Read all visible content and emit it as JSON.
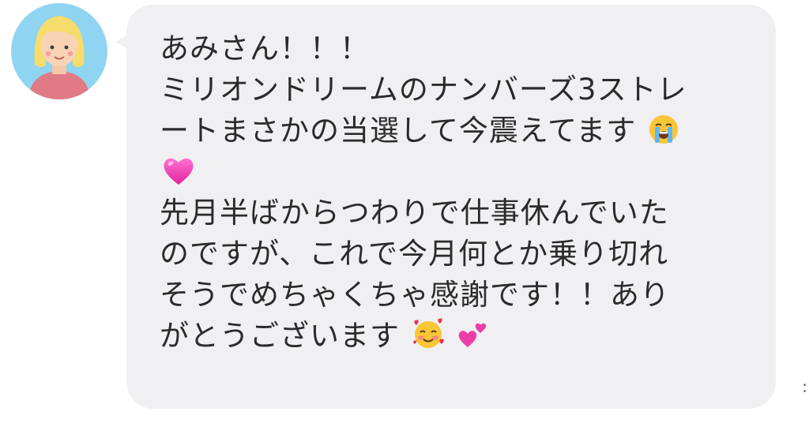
{
  "message": {
    "lines": [
      "あみさん！！！",
      "ミリオンドリームのナンバーズ3ストレ",
      "ートまさかの当選して今震えてます",
      "",
      "先月半ばからつわりで仕事休んでいた",
      "のですが、これで今月何とか乗り切れ",
      "そうでめちゃくちゃ感謝です！！あり",
      "がとうございます"
    ],
    "emojis": [
      "crying-face",
      "pink-heart",
      "smiling-face-with-hearts",
      "two-hearts"
    ]
  },
  "colors": {
    "bubble": "#f0f0f2",
    "text": "#2b2b2b",
    "avatar_bg": "#8fd4f0"
  }
}
